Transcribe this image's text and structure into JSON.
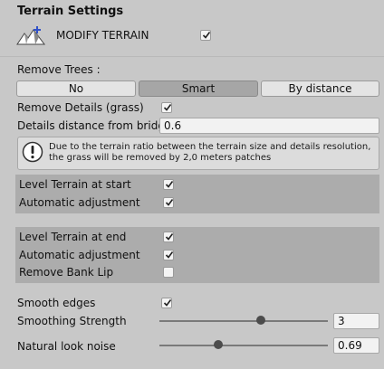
{
  "header": {
    "title": "Terrain Settings"
  },
  "modify": {
    "label": "MODIFY TERRAIN",
    "checked": true,
    "icon": "terrain-icon"
  },
  "remove_trees": {
    "label": "Remove Trees :",
    "options": [
      "No",
      "Smart",
      "By distance"
    ],
    "selected": "Smart"
  },
  "remove_details": {
    "label": "Remove Details (grass)",
    "checked": true
  },
  "details_distance": {
    "label": "Details distance from bridge",
    "value": "0.6"
  },
  "help": {
    "icon": "exclamation-icon",
    "text": "Due to the terrain ratio between the terrain size and details resolution, the grass will be removed by 2,0 meters patches"
  },
  "start_group": {
    "level_label": "Level Terrain at start",
    "level_checked": true,
    "auto_label": "Automatic adjustment",
    "auto_checked": true
  },
  "end_group": {
    "level_label": "Level Terrain at end",
    "level_checked": true,
    "auto_label": "Automatic adjustment",
    "auto_checked": true,
    "bank_label": "Remove Bank Lip",
    "bank_checked": false
  },
  "smooth": {
    "edges_label": "Smooth edges",
    "edges_checked": true,
    "strength_label": "Smoothing Strength",
    "strength_value": "3",
    "strength_fraction": 0.6,
    "noise_label": "Natural look noise",
    "noise_value": "0.69",
    "noise_fraction": 0.35
  }
}
